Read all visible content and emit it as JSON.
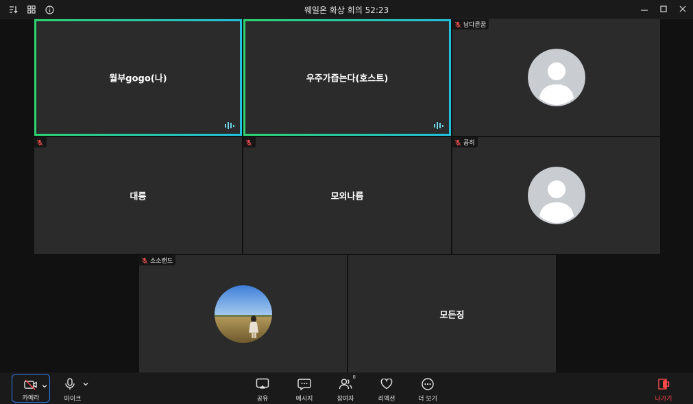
{
  "window": {
    "title": "웨일온 화상 회의 52:23"
  },
  "participants": [
    {
      "name": "월부gogo(나)",
      "speaking": true
    },
    {
      "name": "우주가즙는다(호스트)",
      "speaking": true
    },
    {
      "name": "남다른꿈",
      "muted": true,
      "avatar": "default"
    },
    {
      "name": "대릉",
      "muted": true
    },
    {
      "name": "모외나름",
      "muted": true
    },
    {
      "name": "곰히",
      "muted": true,
      "avatar": "default"
    },
    {
      "name": "소소랜드",
      "muted": true,
      "avatar": "photo"
    },
    {
      "name": "모든징"
    }
  ],
  "toolbar": {
    "camera_label": "카메라",
    "mic_label": "마이크",
    "share_label": "공유",
    "message_label": "메시지",
    "participants_label": "참여자",
    "participants_count": "8",
    "reaction_label": "리액션",
    "more_label": "더 보기",
    "leave_label": "나가기"
  },
  "colors": {
    "speaking_border_start": "#2dd36f",
    "speaking_border_end": "#22c1dd",
    "camera_focus": "#2f7cf6",
    "leave": "#ff4a4a",
    "muted": "#e34b4b"
  }
}
